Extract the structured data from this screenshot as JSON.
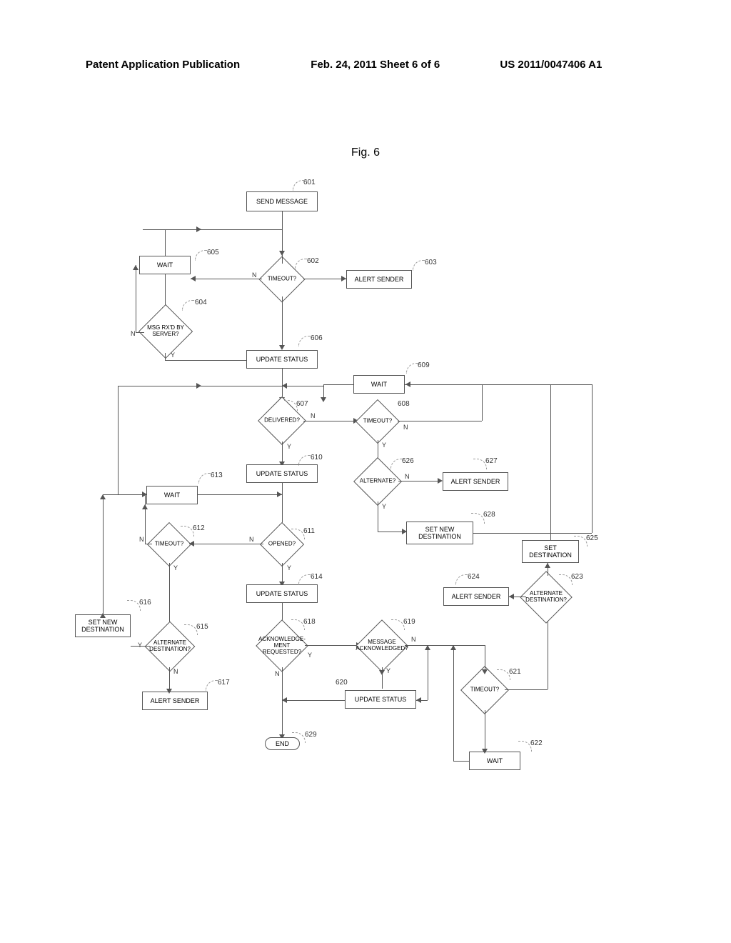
{
  "header": {
    "left": "Patent Application Publication",
    "mid": "Feb. 24, 2011  Sheet 6 of 6",
    "right": "US 2011/0047406 A1"
  },
  "figure_title": "Fig. 6",
  "nodes": {
    "n601": "SEND MESSAGE",
    "n602": "TIMEOUT?",
    "n603": "ALERT SENDER",
    "n604": "MSG RX'D BY\nSERVER?",
    "n605": "WAIT",
    "n606": "UPDATE STATUS",
    "n607": "DELIVERED?",
    "n608": "TIMEOUT?",
    "n609": "WAIT",
    "n610": "UPDATE STATUS",
    "n611": "OPENED?",
    "n612": "TIMEOUT?",
    "n613": "WAIT",
    "n614": "UPDATE STATUS",
    "n615": "ALTERNATE\nDESTINATION?",
    "n616": "SET NEW\nDESTINATION",
    "n617": "ALERT SENDER",
    "n618": "ACKNOWLEDGE-\nMENT\nREQUESTED?",
    "n619": "MESSAGE\nACKNOWLEDGED?",
    "n620": "UPDATE STATUS",
    "n621": "TIMEOUT?",
    "n622": "WAIT",
    "n623": "ALTERNATE\nDESTINATION?",
    "n624": "ALERT SENDER",
    "n625": "SET\nDESTINATION",
    "n626": "ALTERNATE?",
    "n627": "ALERT SENDER",
    "n628": "SET NEW\nDESTINATION",
    "n629": "END"
  },
  "refs": {
    "r601": "601",
    "r602": "602",
    "r603": "603",
    "r604": "604",
    "r605": "605",
    "r606": "606",
    "r607": "607",
    "r608": "608",
    "r609": "609",
    "r610": "610",
    "r611": "611",
    "r612": "612",
    "r613": "613",
    "r614": "614",
    "r615": "615",
    "r616": "616",
    "r617": "617",
    "r618": "618",
    "r619": "619",
    "r620": "620",
    "r621": "621",
    "r622": "622",
    "r623": "623",
    "r624": "624",
    "r625": "625",
    "r626": "626",
    "r627": "627",
    "r628": "628",
    "r629": "629"
  },
  "labels": {
    "Y": "Y",
    "N": "N"
  }
}
